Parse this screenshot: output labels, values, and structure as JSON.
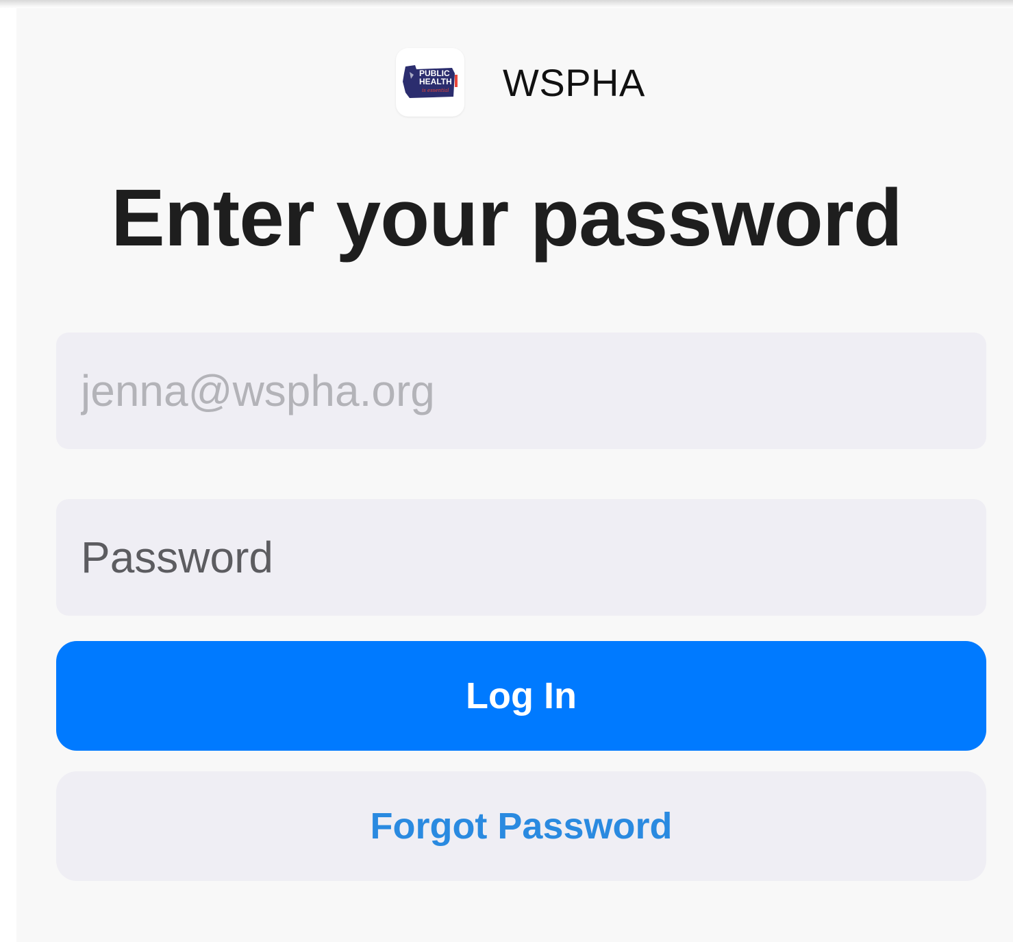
{
  "app": {
    "name": "WSPHA",
    "logo_icon": "washington-state-public-health-logo-icon",
    "logo_text_lines": [
      "PUBLIC",
      "HEALTH",
      "is essential"
    ]
  },
  "page": {
    "title": "Enter your password"
  },
  "form": {
    "email_placeholder": "jenna@wspha.org",
    "email_value": "",
    "password_placeholder": "Password",
    "password_value": ""
  },
  "actions": {
    "login_label": "Log In",
    "forgot_label": "Forgot Password"
  },
  "colors": {
    "accent": "#007aff",
    "link": "#2a8ae0",
    "field_bg": "#efeef4",
    "screen_bg": "#f8f8f8"
  }
}
